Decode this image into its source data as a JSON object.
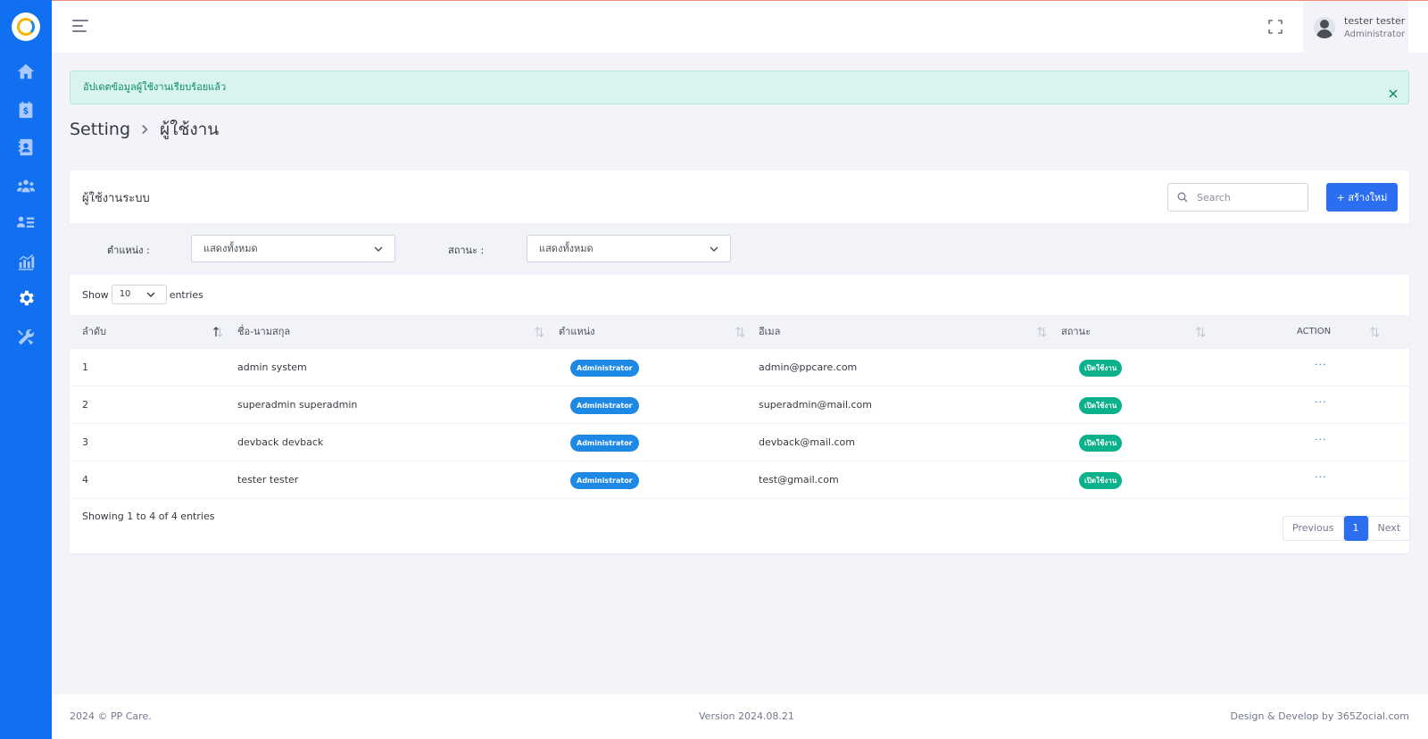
{
  "topbar": {
    "user_name": "tester tester",
    "user_role": "Administrator"
  },
  "alert": {
    "message": "อัปเดตข้อมูลผู้ใช้งานเรียบร้อยแล้ว"
  },
  "breadcrumb": {
    "parent": "Setting",
    "current": "ผู้ใช้งาน"
  },
  "card": {
    "title": "ผู้ใช้งานระบบ",
    "search_placeholder": "Search",
    "create_label": "+  สร้างใหม่"
  },
  "filters": {
    "position_label": "ตำแหน่ง :",
    "position_value": "แสดงทั้งหมด",
    "status_label": "สถานะ :",
    "status_value": "แสดงทั้งหมด"
  },
  "length": {
    "show": "Show",
    "value": "10",
    "entries": "entries"
  },
  "table": {
    "headers": [
      "ลำดับ",
      "ชื่อ-นามสกุล",
      "ตำแหน่ง",
      "อีเมล",
      "สถานะ",
      "ACTION"
    ],
    "rows": [
      {
        "no": "1",
        "name": "admin system",
        "role": "Administrator",
        "email": "admin@ppcare.com",
        "status": "เปิดใช้งาน",
        "action": "···"
      },
      {
        "no": "2",
        "name": "superadmin superadmin",
        "role": "Administrator",
        "email": "superadmin@mail.com",
        "status": "เปิดใช้งาน",
        "action": "···"
      },
      {
        "no": "3",
        "name": "devback devback",
        "role": "Administrator",
        "email": "devback@mail.com",
        "status": "เปิดใช้งาน",
        "action": "···"
      },
      {
        "no": "4",
        "name": "tester tester",
        "role": "Administrator",
        "email": "test@gmail.com",
        "status": "เปิดใช้งาน",
        "action": "···"
      }
    ]
  },
  "pagination": {
    "info": "Showing 1 to 4 of 4 entries",
    "prev": "Previous",
    "current": "1",
    "next": "Next"
  },
  "footer": {
    "left": "2024 © PP Care.",
    "center": "Version 2024.08.21",
    "right": "Design & Develop by 365Zocial.com"
  },
  "colors": {
    "sidebar": "#1070f0",
    "primary": "#2b6ff0",
    "role_badge": "#1e88e5",
    "status_badge": "#0bb18a",
    "alert_bg": "#d9f4ee"
  }
}
